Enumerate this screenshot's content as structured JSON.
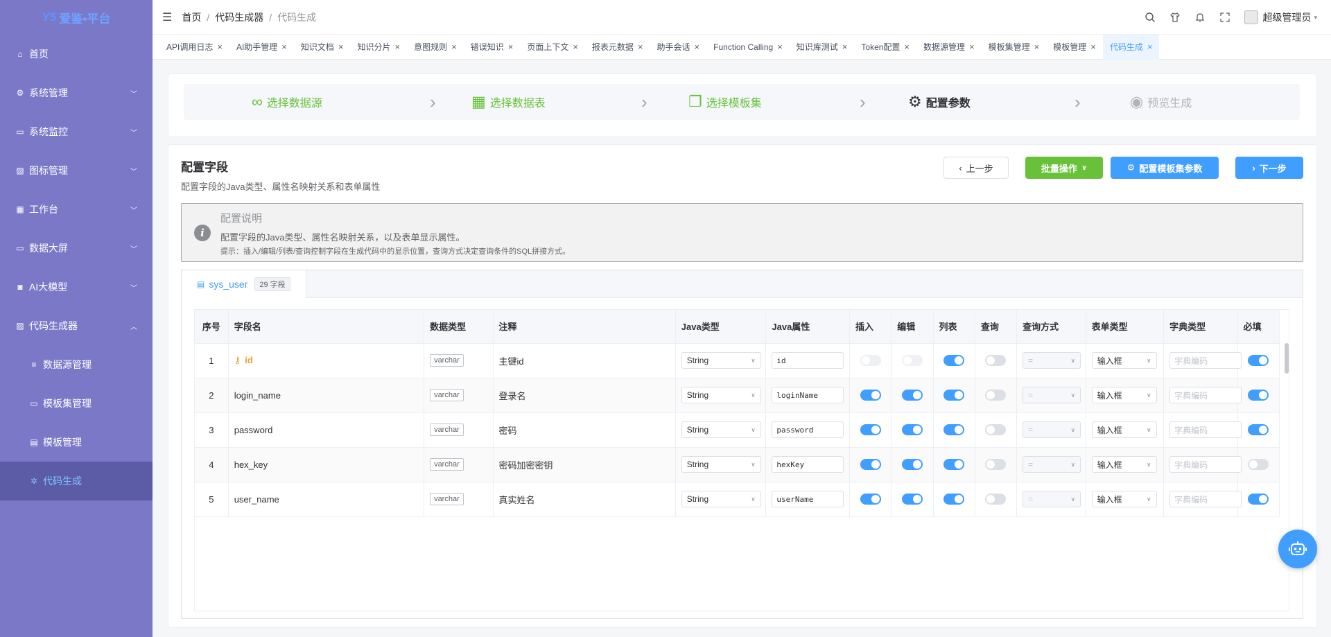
{
  "app": {
    "logo_mark": "Y5",
    "logo_text": "爱鉴•平台"
  },
  "sidebar": {
    "items": [
      {
        "label": "首页",
        "icon": "home-icon",
        "glyph": "⌂",
        "expandable": false
      },
      {
        "label": "系统管理",
        "icon": "gear-icon",
        "glyph": "⚙",
        "expandable": true
      },
      {
        "label": "系统监控",
        "icon": "monitor-icon",
        "glyph": "▭",
        "expandable": true
      },
      {
        "label": "图标管理",
        "icon": "image-icon",
        "glyph": "▨",
        "expandable": true
      },
      {
        "label": "工作台",
        "icon": "grid-icon",
        "glyph": "▦",
        "expandable": true
      },
      {
        "label": "数据大屏",
        "icon": "screen-icon",
        "glyph": "▭",
        "expandable": true
      },
      {
        "label": "AI大模型",
        "icon": "robot-icon",
        "glyph": "◙",
        "expandable": true
      },
      {
        "label": "代码生成器",
        "icon": "code-icon",
        "glyph": "▨",
        "expandable": true
      }
    ],
    "subitems": [
      {
        "label": "数据源管理",
        "icon": "database-icon",
        "glyph": "≡"
      },
      {
        "label": "模板集管理",
        "icon": "folder-icon",
        "glyph": "▭"
      },
      {
        "label": "模板管理",
        "icon": "file-icon",
        "glyph": "▤"
      },
      {
        "label": "代码生成",
        "icon": "settings-icon",
        "glyph": "✲",
        "active": true
      }
    ]
  },
  "header": {
    "breadcrumb": [
      "首页",
      "代码生成器",
      "代码生成"
    ],
    "separator": "/",
    "user": "超级管理员"
  },
  "tabs": [
    "API调用日志",
    "AI助手管理",
    "知识文档",
    "知识分片",
    "意图规则",
    "错误知识",
    "页面上下文",
    "报表元数据",
    "助手会话",
    "Function Calling",
    "知识库测试",
    "Token配置",
    "数据源管理",
    "模板集管理",
    "模板管理",
    "代码生成"
  ],
  "active_tab": "代码生成",
  "steps": [
    {
      "label": "选择数据源",
      "state": "done",
      "icon": "link-icon",
      "glyph": "∞"
    },
    {
      "label": "选择数据表",
      "state": "done",
      "icon": "table-grid-icon",
      "glyph": "▦"
    },
    {
      "label": "选择模板集",
      "state": "done",
      "icon": "copy-icon",
      "glyph": "❐"
    },
    {
      "label": "配置参数",
      "state": "current",
      "icon": "gear-icon",
      "glyph": "⚙"
    },
    {
      "label": "预览生成",
      "state": "todo",
      "icon": "eye-icon",
      "glyph": "◉"
    }
  ],
  "config": {
    "title": "配置字段",
    "subtitle": "配置字段的Java类型、属性名映射关系和表单属性",
    "buttons": {
      "prev": "上一步",
      "batch": "批量操作",
      "tpl_params": "配置模板集参数",
      "next": "下一步"
    },
    "notice": {
      "title": "配置说明",
      "desc": "配置字段的Java类型、属性名映射关系，以及表单显示属性。",
      "hint": "提示：插入/编辑/列表/查询控制字段在生成代码中的显示位置，查询方式决定查询条件的SQL拼接方式。"
    },
    "table_tab": {
      "name": "sys_user",
      "count": "29 字段"
    },
    "columns": [
      "序号",
      "字段名",
      "数据类型",
      "注释",
      "Java类型",
      "Java属性",
      "插入",
      "编辑",
      "列表",
      "查询",
      "查询方式",
      "表单类型",
      "字典类型",
      "必填"
    ],
    "rows": [
      {
        "no": "1",
        "field": "id",
        "pk": true,
        "dtype": "varchar",
        "comment": "主键id",
        "java_type": "String",
        "java_prop": "id",
        "insert": false,
        "edit": false,
        "list": true,
        "query": false,
        "query_mode": "=",
        "form_type": "输入框",
        "dict_placeholder": "字典编码",
        "required": true,
        "insert_disabled": true,
        "edit_disabled": true
      },
      {
        "no": "2",
        "field": "login_name",
        "pk": false,
        "dtype": "varchar",
        "comment": "登录名",
        "java_type": "String",
        "java_prop": "loginName",
        "insert": true,
        "edit": true,
        "list": true,
        "query": false,
        "query_mode": "=",
        "form_type": "输入框",
        "dict_placeholder": "字典编码",
        "required": true
      },
      {
        "no": "3",
        "field": "password",
        "pk": false,
        "dtype": "varchar",
        "comment": "密码",
        "java_type": "String",
        "java_prop": "password",
        "insert": true,
        "edit": true,
        "list": true,
        "query": false,
        "query_mode": "=",
        "form_type": "输入框",
        "dict_placeholder": "字典编码",
        "required": true
      },
      {
        "no": "4",
        "field": "hex_key",
        "pk": false,
        "dtype": "varchar",
        "comment": "密码加密密钥",
        "java_type": "String",
        "java_prop": "hexKey",
        "insert": true,
        "edit": true,
        "list": true,
        "query": false,
        "query_mode": "=",
        "form_type": "输入框",
        "dict_placeholder": "字典编码",
        "required": false
      },
      {
        "no": "5",
        "field": "user_name",
        "pk": false,
        "dtype": "varchar",
        "comment": "真实姓名",
        "java_type": "String",
        "java_prop": "userName",
        "insert": true,
        "edit": true,
        "list": true,
        "query": false,
        "query_mode": "=",
        "form_type": "输入框",
        "dict_placeholder": "字典编码",
        "required": true
      }
    ]
  },
  "colors": {
    "sidebar_bg": "#7b78c8",
    "sidebar_active_bg": "#5c5ba6",
    "primary": "#409eff",
    "success": "#67c23a",
    "warning": "#e6a23c"
  }
}
